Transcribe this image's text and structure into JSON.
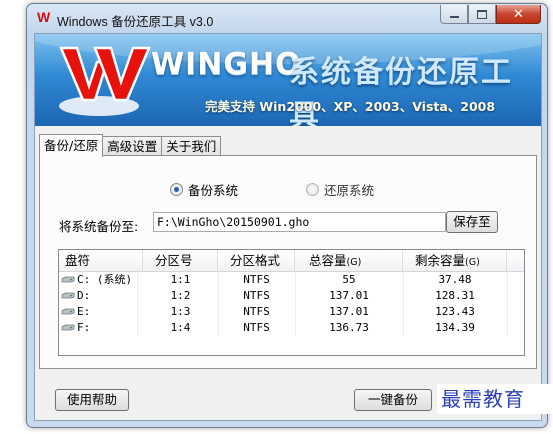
{
  "window": {
    "title": "Windows 备份还原工具 v3.0",
    "app_icon_letter": "W"
  },
  "banner": {
    "brand": "WINGHO",
    "brand_cn": "系统备份还原工具",
    "slogan": "完美支持 Win2000、XP、2003、Vista、2008"
  },
  "tabs": [
    {
      "label": "备份/还原",
      "active": true
    },
    {
      "label": "高级设置",
      "active": false
    },
    {
      "label": "关于我们",
      "active": false
    }
  ],
  "mode": {
    "backup_label": "备份系统",
    "restore_label": "还原系统",
    "selected": "backup"
  },
  "backup_path": {
    "label": "将系统备份至:",
    "value": "F:\\WinGho\\20150901.gho",
    "save_button": "保存至"
  },
  "drive_table": {
    "columns": [
      "盘符",
      "分区号",
      "分区格式",
      "总容量",
      "剩余容量"
    ],
    "unit": "(G)",
    "rows": [
      {
        "drive": "C: (系统)",
        "partition": "1:1",
        "format": "NTFS",
        "total": "55",
        "free": "37.48"
      },
      {
        "drive": "D:",
        "partition": "1:2",
        "format": "NTFS",
        "total": "137.01",
        "free": "128.31"
      },
      {
        "drive": "E:",
        "partition": "1:3",
        "format": "NTFS",
        "total": "137.01",
        "free": "123.43"
      },
      {
        "drive": "F:",
        "partition": "1:4",
        "format": "NTFS",
        "total": "136.73",
        "free": "134.39"
      }
    ]
  },
  "footer": {
    "help_button": "使用帮助",
    "backup_button": "一键备份"
  },
  "watermark": "最需教育",
  "colors": {
    "accent_blue": "#1d66b3",
    "brand_red": "#d10f0f",
    "watermark_blue": "#2a3fb8"
  }
}
